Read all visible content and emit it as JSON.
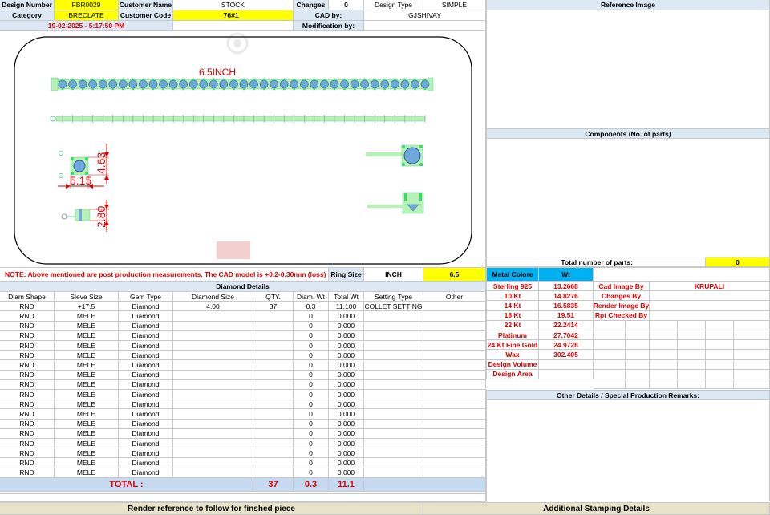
{
  "header": {
    "design_number_label": "Design Number",
    "design_number": "FBR0029",
    "customer_name_label": "Customer Name",
    "customer_name": "STOCK",
    "changes_label": "Changes",
    "changes": "0",
    "design_type_label": "Design Type",
    "design_type": "SIMPLE",
    "reference_image_label": "Reference Image",
    "category_label": "Category",
    "category": "BRECLATE",
    "customer_code_label": "Customer Code",
    "customer_code": "76#1_",
    "cad_by_label": "CAD by:",
    "cad_by": "GJSHIVAY",
    "date": "19-02-2025 - 5:17:50 PM",
    "modification_by_label": "Modification by:"
  },
  "drawing": {
    "length_label": "6.5INCH",
    "dim_width": "5.15",
    "dim_height": "4.63",
    "dim_small": "2.80"
  },
  "note": "NOTE: Above mentioned are post production measurements. The CAD model is +0.2-0.30mm (loss)",
  "ring_size_label": "Ring Size",
  "ring_size_unit": "INCH",
  "ring_size_value": "6.5",
  "components_label": "Components (No. of parts)",
  "total_parts_label": "Total number of parts:",
  "total_parts": "0",
  "diamond_details_label": "Diamond Details",
  "diamond_columns": [
    "Diam Shape",
    "Sieve Size",
    "Gem Type",
    "Diamond Size",
    "QTY.",
    "Diam. Wt",
    "Total Wt",
    "Setting Type",
    "Other"
  ],
  "diamond_rows": [
    [
      "RND",
      "+17.5",
      "Diamond",
      "4.00",
      "37",
      "0.3",
      "11.100",
      "COLLET SETTING",
      ""
    ],
    [
      "RND",
      "MELE",
      "Diamond",
      "",
      "",
      "0",
      "0.000",
      "",
      ""
    ],
    [
      "RND",
      "MELE",
      "Diamond",
      "",
      "",
      "0",
      "0.000",
      "",
      ""
    ],
    [
      "RND",
      "MELE",
      "Diamond",
      "",
      "",
      "0",
      "0.000",
      "",
      ""
    ],
    [
      "RND",
      "MELE",
      "Diamond",
      "",
      "",
      "0",
      "0.000",
      "",
      ""
    ],
    [
      "RND",
      "MELE",
      "Diamond",
      "",
      "",
      "0",
      "0.000",
      "",
      ""
    ],
    [
      "RND",
      "MELE",
      "Diamond",
      "",
      "",
      "0",
      "0.000",
      "",
      ""
    ],
    [
      "RND",
      "MELE",
      "Diamond",
      "",
      "",
      "0",
      "0.000",
      "",
      ""
    ],
    [
      "RND",
      "MELE",
      "Diamond",
      "",
      "",
      "0",
      "0.000",
      "",
      ""
    ],
    [
      "RND",
      "MELE",
      "Diamond",
      "",
      "",
      "0",
      "0.000",
      "",
      ""
    ],
    [
      "RND",
      "MELE",
      "Diamond",
      "",
      "",
      "0",
      "0.000",
      "",
      ""
    ],
    [
      "RND",
      "MELE",
      "Diamond",
      "",
      "",
      "0",
      "0.000",
      "",
      ""
    ],
    [
      "RND",
      "MELE",
      "Diamond",
      "",
      "",
      "0",
      "0.000",
      "",
      ""
    ],
    [
      "RND",
      "MELE",
      "Diamond",
      "",
      "",
      "0",
      "0.000",
      "",
      ""
    ],
    [
      "RND",
      "MELE",
      "Diamond",
      "",
      "",
      "0",
      "0.000",
      "",
      ""
    ],
    [
      "RND",
      "MELE",
      "Diamond",
      "",
      "",
      "0",
      "0.000",
      "",
      ""
    ],
    [
      "RND",
      "MELE",
      "Diamond",
      "",
      "",
      "0",
      "0.000",
      "",
      ""
    ],
    [
      "RND",
      "MELE",
      "Diamond",
      "",
      "",
      "0",
      "0.000",
      "",
      ""
    ]
  ],
  "totals": {
    "label": "TOTAL :",
    "qty": "37",
    "diam_wt": "0.3",
    "total_wt": "11.1"
  },
  "metal": {
    "metal_colore_label": "Metal Colore",
    "wt_label": "Wt",
    "rows": [
      {
        "name": "Sterling 925",
        "wt": "13.2668"
      },
      {
        "name": "10 Kt",
        "wt": "14.8276"
      },
      {
        "name": "14 Kt",
        "wt": "16.5835"
      },
      {
        "name": "18 Kt",
        "wt": "19.51"
      },
      {
        "name": "22 Kt",
        "wt": "22.2414"
      },
      {
        "name": "Platinum",
        "wt": "27.7042"
      },
      {
        "name": "24 Kt Fine Gold",
        "wt": "24.9728"
      },
      {
        "name": "Wax",
        "wt": "302.405"
      },
      {
        "name": "Design Volume",
        "wt": ""
      },
      {
        "name": "Design Area",
        "wt": ""
      }
    ]
  },
  "credits": [
    {
      "label": "Cad Image By",
      "value": "KRUPALI"
    },
    {
      "label": "Changes By",
      "value": ""
    },
    {
      "label": "Render Image By",
      "value": ""
    },
    {
      "label": "Rpt Checked By",
      "value": ""
    }
  ],
  "other_details_label": "Other Details / Special Production Remarks:",
  "footer": {
    "render_reference": "Render reference to follow for finshed piece",
    "additional_stamping": "Additional Stamping Details"
  },
  "colors": {
    "label_bg": "#dde8f5",
    "highlight_yellow": "#ffff00",
    "highlight_blue": "#00b0f0",
    "text_red": "#e00000",
    "stone_blue": "#6fa8dc",
    "metal_green": "#b6f2b6"
  }
}
